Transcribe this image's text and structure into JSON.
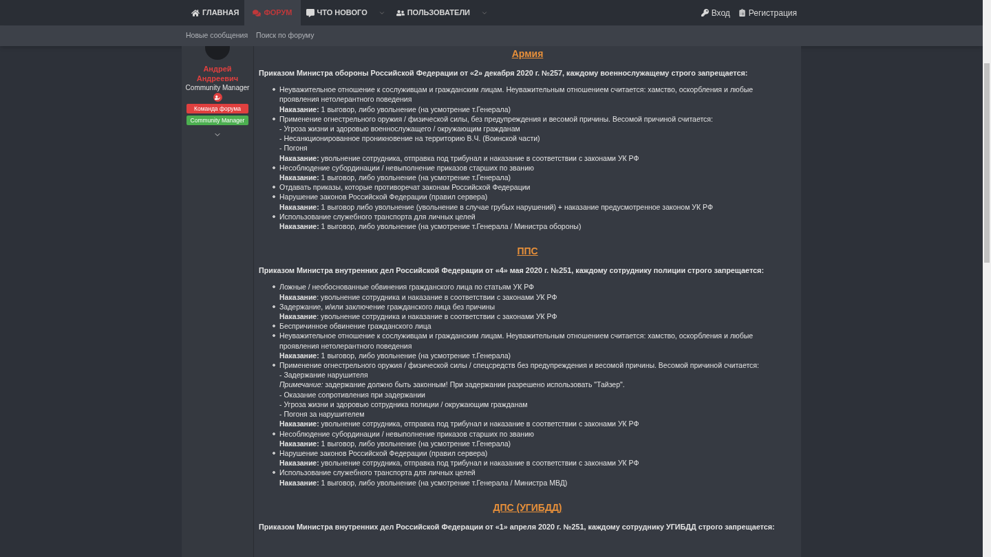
{
  "nav": {
    "tabs": [
      {
        "label": "ГЛАВНАЯ",
        "selected": false,
        "dropdown": false
      },
      {
        "label": "ФОРУМ",
        "selected": true,
        "dropdown": false
      },
      {
        "label": "ЧТО НОВОГО",
        "selected": false,
        "dropdown": true
      },
      {
        "label": "ПОЛЬЗОВАТЕЛИ",
        "selected": false,
        "dropdown": true
      }
    ],
    "account": [
      {
        "label": "Вход"
      },
      {
        "label": "Регистрация"
      }
    ],
    "subnav": [
      "Новые сообщения",
      "Поиск по форуму"
    ]
  },
  "author": {
    "name": "Андрей Андреевич",
    "title": "Community Manager",
    "banners": [
      {
        "label": "Команда форума",
        "color": "#e0403f"
      },
      {
        "label": "Community Manager",
        "color": "#4caf50"
      }
    ]
  },
  "sections": [
    {
      "heading": "Армия",
      "order": "Приказом Министра обороны Российской Федерации от «2» декабря 2020 г. №257, каждому военнослужащему строго запрещается:",
      "items": [
        {
          "lines": [
            "Неуважительное отношение к сослуживцам и гражданским лицам. Неуважительным отношением считается: хамство, оскорбления и любые проявления нетолерантного поведения",
            "**Наказание:** 1 выговор, либо увольнение (на усмотрение т.Генерала)"
          ]
        },
        {
          "lines": [
            "Применение огнестрельного оружия / физической силы, без предупреждения и весомой причины. Весомой причиной считается:",
            "- Угроза жизни и здоровью военнослужащего / окружающим гражданам",
            "- Несанкционированное проникновение на территорию В.Ч. (Воинской части)",
            "- Погоня",
            "**Наказание:** увольнение сотрудника, отправка под трибунал и наказание в соответствии с законами УК РФ"
          ]
        },
        {
          "lines": [
            "Несоблюдение субординации / невыполнение приказов старших по званию",
            "**Наказание:** 1 выговор, либо увольнение (на усмотрение т.Генерала)"
          ]
        },
        {
          "lines": [
            "Отдавать приказы, которые противоречат законам Российской Федерации"
          ]
        },
        {
          "lines": [
            "Нарушение законов Российской Федерации (правил сервера)",
            "**Наказание:** 1 выговор либо увольнение (увольнение в случае грубых нарушений) + наказание предусмотренное законом УК РФ"
          ]
        },
        {
          "lines": [
            "Использование служебного транспорта для личных целей",
            "**Наказание:** 1 выговор, либо увольнение (на усмотрение т.Генерала / Министра обороны)"
          ]
        }
      ]
    },
    {
      "heading": "ППС",
      "order": "Приказом Министра внутренних дел Российской Федерации от «4» мая 2020 г. №251, каждому сотруднику полиции строго запрещается:",
      "items": [
        {
          "lines": [
            "Ложные / необоснованные обвинения гражданского лица по статьям УК РФ",
            "**Наказание**: увольнение сотрудника и наказание в соответствии с законами УК РФ"
          ]
        },
        {
          "lines": [
            "Задержание, и/или заключение гражданского лица без причины",
            "**Наказание**: увольнение сотрудника и наказание в соответствии с законами УК РФ"
          ]
        },
        {
          "lines": [
            "Беспричинное обвинение гражданского лица"
          ]
        },
        {
          "lines": [
            "Неуважительное отношение к сослуживцам и гражданским лицам. Неуважительным отношением считается: хамство, оскорбления и любые проявления нетолерантного поведения",
            "**Наказание:** 1 выговор, либо увольнение (на усмотрение т.Генерала)"
          ]
        },
        {
          "lines": [
            "Применение огнестрельного оружия / физической силы / спецсредств без предупреждения и весомой причины. Весомой причиной считается:",
            "- Задержание нарушителя",
            "*Примечание:* задержание должно быть законным! При задержании разрешено использовать \"Тайзер\".",
            "- Оказание сопротивления при задержании",
            "- Угроза жизни и здоровью сотрудника полиции / окружающим гражданам",
            "- Погоня за нарушителем",
            "**Наказание:** увольнение сотрудника, отправка под трибунал и наказание в соответствии с законами УК РФ"
          ]
        },
        {
          "lines": [
            "Несоблюдение субординации / невыполнение приказов старших по званию",
            "**Наказание:** 1 выговор, либо увольнение (на усмотрение т.Генерала)"
          ]
        },
        {
          "lines": [
            "Нарушение законов Российской Федерации (правил сервера)",
            "**Наказание:** увольнение сотрудника, отправка под трибунал и наказание в соответствии с законами УК РФ"
          ]
        },
        {
          "lines": [
            "Использование служебного транспорта для личных целей",
            "**Наказание:** 1 выговор, либо увольнение (на усмотрение т.Генерала / Министра МВД)"
          ]
        }
      ]
    },
    {
      "heading": "ДПС (УГИБДД)",
      "order": "Приказом Министра внутренних дел Российской Федерации от «1» апреля 2020 г. №251, каждому сотруднику УГИБДД строго запрещается:"
    }
  ]
}
